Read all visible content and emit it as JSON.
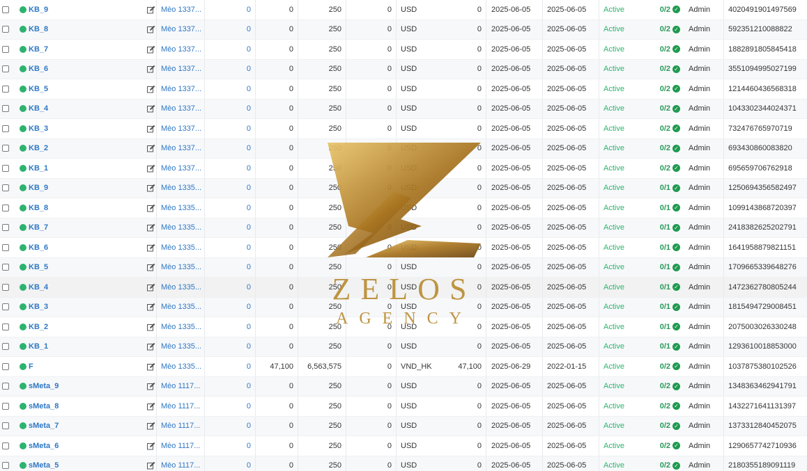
{
  "rows": [
    {
      "name": "KB_9",
      "meo": "Mèo 1337...",
      "link": "0",
      "a": "0",
      "b": "250",
      "c": "0",
      "cur": "USD",
      "d": "0",
      "date1": "2025-06-05",
      "date2": "2025-06-05",
      "status": "Active",
      "ratio": "0/2",
      "owner": "Admin",
      "id": "4020491901497569"
    },
    {
      "name": "KB_8",
      "meo": "Mèo 1337...",
      "link": "0",
      "a": "0",
      "b": "250",
      "c": "0",
      "cur": "USD",
      "d": "0",
      "date1": "2025-06-05",
      "date2": "2025-06-05",
      "status": "Active",
      "ratio": "0/2",
      "owner": "Admin",
      "id": "592351210088822"
    },
    {
      "name": "KB_7",
      "meo": "Mèo 1337...",
      "link": "0",
      "a": "0",
      "b": "250",
      "c": "0",
      "cur": "USD",
      "d": "0",
      "date1": "2025-06-05",
      "date2": "2025-06-05",
      "status": "Active",
      "ratio": "0/2",
      "owner": "Admin",
      "id": "1882891805845418"
    },
    {
      "name": "KB_6",
      "meo": "Mèo 1337...",
      "link": "0",
      "a": "0",
      "b": "250",
      "c": "0",
      "cur": "USD",
      "d": "0",
      "date1": "2025-06-05",
      "date2": "2025-06-05",
      "status": "Active",
      "ratio": "0/2",
      "owner": "Admin",
      "id": "3551094995027199"
    },
    {
      "name": "KB_5",
      "meo": "Mèo 1337...",
      "link": "0",
      "a": "0",
      "b": "250",
      "c": "0",
      "cur": "USD",
      "d": "0",
      "date1": "2025-06-05",
      "date2": "2025-06-05",
      "status": "Active",
      "ratio": "0/2",
      "owner": "Admin",
      "id": "1214460436568318"
    },
    {
      "name": "KB_4",
      "meo": "Mèo 1337...",
      "link": "0",
      "a": "0",
      "b": "250",
      "c": "0",
      "cur": "USD",
      "d": "0",
      "date1": "2025-06-05",
      "date2": "2025-06-05",
      "status": "Active",
      "ratio": "0/2",
      "owner": "Admin",
      "id": "1043302344024371"
    },
    {
      "name": "KB_3",
      "meo": "Mèo 1337...",
      "link": "0",
      "a": "0",
      "b": "250",
      "c": "0",
      "cur": "USD",
      "d": "0",
      "date1": "2025-06-05",
      "date2": "2025-06-05",
      "status": "Active",
      "ratio": "0/2",
      "owner": "Admin",
      "id": "732476765970719"
    },
    {
      "name": "KB_2",
      "meo": "Mèo 1337...",
      "link": "0",
      "a": "0",
      "b": "250",
      "c": "0",
      "cur": "USD",
      "d": "0",
      "date1": "2025-06-05",
      "date2": "2025-06-05",
      "status": "Active",
      "ratio": "0/2",
      "owner": "Admin",
      "id": "693430860083820"
    },
    {
      "name": "KB_1",
      "meo": "Mèo 1337...",
      "link": "0",
      "a": "0",
      "b": "250",
      "c": "0",
      "cur": "USD",
      "d": "0",
      "date1": "2025-06-05",
      "date2": "2025-06-05",
      "status": "Active",
      "ratio": "0/2",
      "owner": "Admin",
      "id": "695659706762918"
    },
    {
      "name": "KB_9",
      "meo": "Mèo 1335...",
      "link": "0",
      "a": "0",
      "b": "250",
      "c": "0",
      "cur": "USD",
      "d": "0",
      "date1": "2025-06-05",
      "date2": "2025-06-05",
      "status": "Active",
      "ratio": "0/1",
      "owner": "Admin",
      "id": "1250694356582497"
    },
    {
      "name": "KB_8",
      "meo": "Mèo 1335...",
      "link": "0",
      "a": "0",
      "b": "250",
      "c": "0",
      "cur": "USD",
      "d": "0",
      "date1": "2025-06-05",
      "date2": "2025-06-05",
      "status": "Active",
      "ratio": "0/1",
      "owner": "Admin",
      "id": "1099143868720397"
    },
    {
      "name": "KB_7",
      "meo": "Mèo 1335...",
      "link": "0",
      "a": "0",
      "b": "250",
      "c": "0",
      "cur": "USD",
      "d": "0",
      "date1": "2025-06-05",
      "date2": "2025-06-05",
      "status": "Active",
      "ratio": "0/1",
      "owner": "Admin",
      "id": "2418382625202791"
    },
    {
      "name": "KB_6",
      "meo": "Mèo 1335...",
      "link": "0",
      "a": "0",
      "b": "250",
      "c": "0",
      "cur": "USD",
      "d": "0",
      "date1": "2025-06-05",
      "date2": "2025-06-05",
      "status": "Active",
      "ratio": "0/1",
      "owner": "Admin",
      "id": "1641958879821151"
    },
    {
      "name": "KB_5",
      "meo": "Mèo 1335...",
      "link": "0",
      "a": "0",
      "b": "250",
      "c": "0",
      "cur": "USD",
      "d": "0",
      "date1": "2025-06-05",
      "date2": "2025-06-05",
      "status": "Active",
      "ratio": "0/1",
      "owner": "Admin",
      "id": "1709665339648276"
    },
    {
      "name": "KB_4",
      "meo": "Mèo 1335...",
      "link": "0",
      "a": "0",
      "b": "250",
      "c": "0",
      "cur": "USD",
      "d": "0",
      "date1": "2025-06-05",
      "date2": "2025-06-05",
      "status": "Active",
      "ratio": "0/1",
      "owner": "Admin",
      "id": "1472362780805244"
    },
    {
      "name": "KB_3",
      "meo": "Mèo 1335...",
      "link": "0",
      "a": "0",
      "b": "250",
      "c": "0",
      "cur": "USD",
      "d": "0",
      "date1": "2025-06-05",
      "date2": "2025-06-05",
      "status": "Active",
      "ratio": "0/1",
      "owner": "Admin",
      "id": "1815494729008451"
    },
    {
      "name": "KB_2",
      "meo": "Mèo 1335...",
      "link": "0",
      "a": "0",
      "b": "250",
      "c": "0",
      "cur": "USD",
      "d": "0",
      "date1": "2025-06-05",
      "date2": "2025-06-05",
      "status": "Active",
      "ratio": "0/1",
      "owner": "Admin",
      "id": "2075003026330248"
    },
    {
      "name": "KB_1",
      "meo": "Mèo 1335...",
      "link": "0",
      "a": "0",
      "b": "250",
      "c": "0",
      "cur": "USD",
      "d": "0",
      "date1": "2025-06-05",
      "date2": "2025-06-05",
      "status": "Active",
      "ratio": "0/1",
      "owner": "Admin",
      "id": "1293610018853000"
    },
    {
      "name": "F",
      "meo": "Mèo 1335...",
      "link": "0",
      "a": "47,100",
      "b": "6,563,575",
      "c": "0",
      "cur": "VND_HK",
      "d": "47,100",
      "date1": "2025-06-29",
      "date2": "2022-01-15",
      "status": "Active",
      "ratio": "0/2",
      "owner": "Admin",
      "id": "1037875380102526"
    },
    {
      "name": "sMeta_9",
      "meo": "Mèo 1117...",
      "link": "0",
      "a": "0",
      "b": "250",
      "c": "0",
      "cur": "USD",
      "d": "0",
      "date1": "2025-06-05",
      "date2": "2025-06-05",
      "status": "Active",
      "ratio": "0/2",
      "owner": "Admin",
      "id": "1348363462941791"
    },
    {
      "name": "sMeta_8",
      "meo": "Mèo 1117...",
      "link": "0",
      "a": "0",
      "b": "250",
      "c": "0",
      "cur": "USD",
      "d": "0",
      "date1": "2025-06-05",
      "date2": "2025-06-05",
      "status": "Active",
      "ratio": "0/2",
      "owner": "Admin",
      "id": "1432271641131397"
    },
    {
      "name": "sMeta_7",
      "meo": "Mèo 1117...",
      "link": "0",
      "a": "0",
      "b": "250",
      "c": "0",
      "cur": "USD",
      "d": "0",
      "date1": "2025-06-05",
      "date2": "2025-06-05",
      "status": "Active",
      "ratio": "0/2",
      "owner": "Admin",
      "id": "1373312840452075"
    },
    {
      "name": "sMeta_6",
      "meo": "Mèo 1117...",
      "link": "0",
      "a": "0",
      "b": "250",
      "c": "0",
      "cur": "USD",
      "d": "0",
      "date1": "2025-06-05",
      "date2": "2025-06-05",
      "status": "Active",
      "ratio": "0/2",
      "owner": "Admin",
      "id": "1290657742710936"
    },
    {
      "name": "sMeta_5",
      "meo": "Mèo 1117...",
      "link": "0",
      "a": "0",
      "b": "250",
      "c": "0",
      "cur": "USD",
      "d": "0",
      "date1": "2025-06-05",
      "date2": "2025-06-05",
      "status": "Active",
      "ratio": "0/2",
      "owner": "Admin",
      "id": "2180355189091119"
    }
  ],
  "icons": {
    "status_dot": "status-dot-icon",
    "edit": "edit-icon",
    "checkmark": "check-circle-icon",
    "checkbox": "checkbox-icon"
  },
  "colors": {
    "link": "#2f78c4",
    "active": "#2db36f",
    "ratio": "#1f9a4f",
    "watermark_gold": "#b88a2e"
  },
  "watermark": {
    "line1": "ZELOS",
    "line2": "AGENCY"
  }
}
